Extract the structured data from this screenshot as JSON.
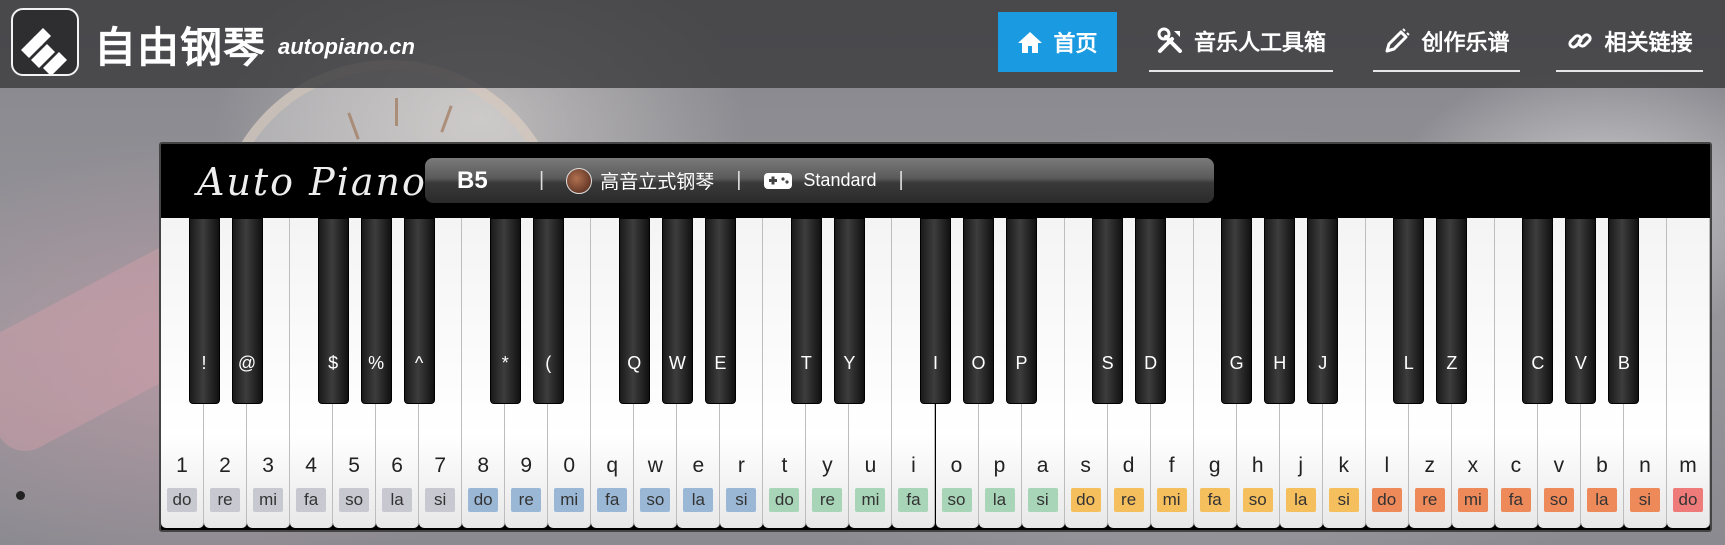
{
  "header": {
    "site_title": "自由钢琴",
    "site_domain": "autopiano.cn",
    "nav": [
      {
        "label": "首页",
        "icon": "home-icon",
        "active": true
      },
      {
        "label": "音乐人工具箱",
        "icon": "tools-icon",
        "active": false
      },
      {
        "label": "创作乐谱",
        "icon": "pen-icon",
        "active": false
      },
      {
        "label": "相关链接",
        "icon": "link-icon",
        "active": false
      }
    ]
  },
  "piano": {
    "brand": "Auto Piano",
    "current_note": "B5",
    "separator": "|",
    "instrument": "高音立式钢琴",
    "mode": "Standard",
    "white_keys": [
      {
        "char": "1",
        "solfa": "do",
        "color": "#c8c8d0"
      },
      {
        "char": "2",
        "solfa": "re",
        "color": "#c8c8d0"
      },
      {
        "char": "3",
        "solfa": "mi",
        "color": "#c8c8d0"
      },
      {
        "char": "4",
        "solfa": "fa",
        "color": "#c8c8d0"
      },
      {
        "char": "5",
        "solfa": "so",
        "color": "#c8c8d0"
      },
      {
        "char": "6",
        "solfa": "la",
        "color": "#c8c8d0"
      },
      {
        "char": "7",
        "solfa": "si",
        "color": "#c8c8d0"
      },
      {
        "char": "8",
        "solfa": "do",
        "color": "#9ab8d6"
      },
      {
        "char": "9",
        "solfa": "re",
        "color": "#9ab8d6"
      },
      {
        "char": "0",
        "solfa": "mi",
        "color": "#9ab8d6"
      },
      {
        "char": "q",
        "solfa": "fa",
        "color": "#9ab8d6"
      },
      {
        "char": "w",
        "solfa": "so",
        "color": "#9ab8d6"
      },
      {
        "char": "e",
        "solfa": "la",
        "color": "#9ab8d6"
      },
      {
        "char": "r",
        "solfa": "si",
        "color": "#9ab8d6"
      },
      {
        "char": "t",
        "solfa": "do",
        "color": "#a8d4b8"
      },
      {
        "char": "y",
        "solfa": "re",
        "color": "#a8d4b8"
      },
      {
        "char": "u",
        "solfa": "mi",
        "color": "#a8d4b8"
      },
      {
        "char": "i",
        "solfa": "fa",
        "color": "#a8d4b8"
      },
      {
        "char": "o",
        "solfa": "so",
        "color": "#a8d4b8"
      },
      {
        "char": "p",
        "solfa": "la",
        "color": "#a8d4b8"
      },
      {
        "char": "a",
        "solfa": "si",
        "color": "#a8d4b8"
      },
      {
        "char": "s",
        "solfa": "do",
        "color": "#f6bf5e"
      },
      {
        "char": "d",
        "solfa": "re",
        "color": "#f6bf5e"
      },
      {
        "char": "f",
        "solfa": "mi",
        "color": "#f6bf5e"
      },
      {
        "char": "g",
        "solfa": "fa",
        "color": "#f6bf5e"
      },
      {
        "char": "h",
        "solfa": "so",
        "color": "#f6bf5e"
      },
      {
        "char": "j",
        "solfa": "la",
        "color": "#f6bf5e"
      },
      {
        "char": "k",
        "solfa": "si",
        "color": "#f6bf5e"
      },
      {
        "char": "l",
        "solfa": "do",
        "color": "#ee8a5a"
      },
      {
        "char": "z",
        "solfa": "re",
        "color": "#ee8a5a"
      },
      {
        "char": "x",
        "solfa": "mi",
        "color": "#ee8a5a"
      },
      {
        "char": "c",
        "solfa": "fa",
        "color": "#ee8a5a"
      },
      {
        "char": "v",
        "solfa": "so",
        "color": "#ee8a5a"
      },
      {
        "char": "b",
        "solfa": "la",
        "color": "#ee8a5a"
      },
      {
        "char": "n",
        "solfa": "si",
        "color": "#ee8a5a"
      },
      {
        "char": "m",
        "solfa": "do",
        "color": "#ee7a7a"
      }
    ],
    "black_keys": [
      {
        "char": "!",
        "after": 0
      },
      {
        "char": "@",
        "after": 1
      },
      {
        "char": "$",
        "after": 3
      },
      {
        "char": "%",
        "after": 4
      },
      {
        "char": "^",
        "after": 5
      },
      {
        "char": "*",
        "after": 7
      },
      {
        "char": "(",
        "after": 8
      },
      {
        "char": "Q",
        "after": 10
      },
      {
        "char": "W",
        "after": 11
      },
      {
        "char": "E",
        "after": 12
      },
      {
        "char": "T",
        "after": 14
      },
      {
        "char": "Y",
        "after": 15
      },
      {
        "char": "I",
        "after": 17
      },
      {
        "char": "O",
        "after": 18
      },
      {
        "char": "P",
        "after": 19
      },
      {
        "char": "S",
        "after": 21
      },
      {
        "char": "D",
        "after": 22
      },
      {
        "char": "G",
        "after": 24
      },
      {
        "char": "H",
        "after": 25
      },
      {
        "char": "J",
        "after": 26
      },
      {
        "char": "L",
        "after": 28
      },
      {
        "char": "Z",
        "after": 29
      },
      {
        "char": "C",
        "after": 31
      },
      {
        "char": "V",
        "after": 32
      },
      {
        "char": "B",
        "after": 33
      }
    ]
  }
}
